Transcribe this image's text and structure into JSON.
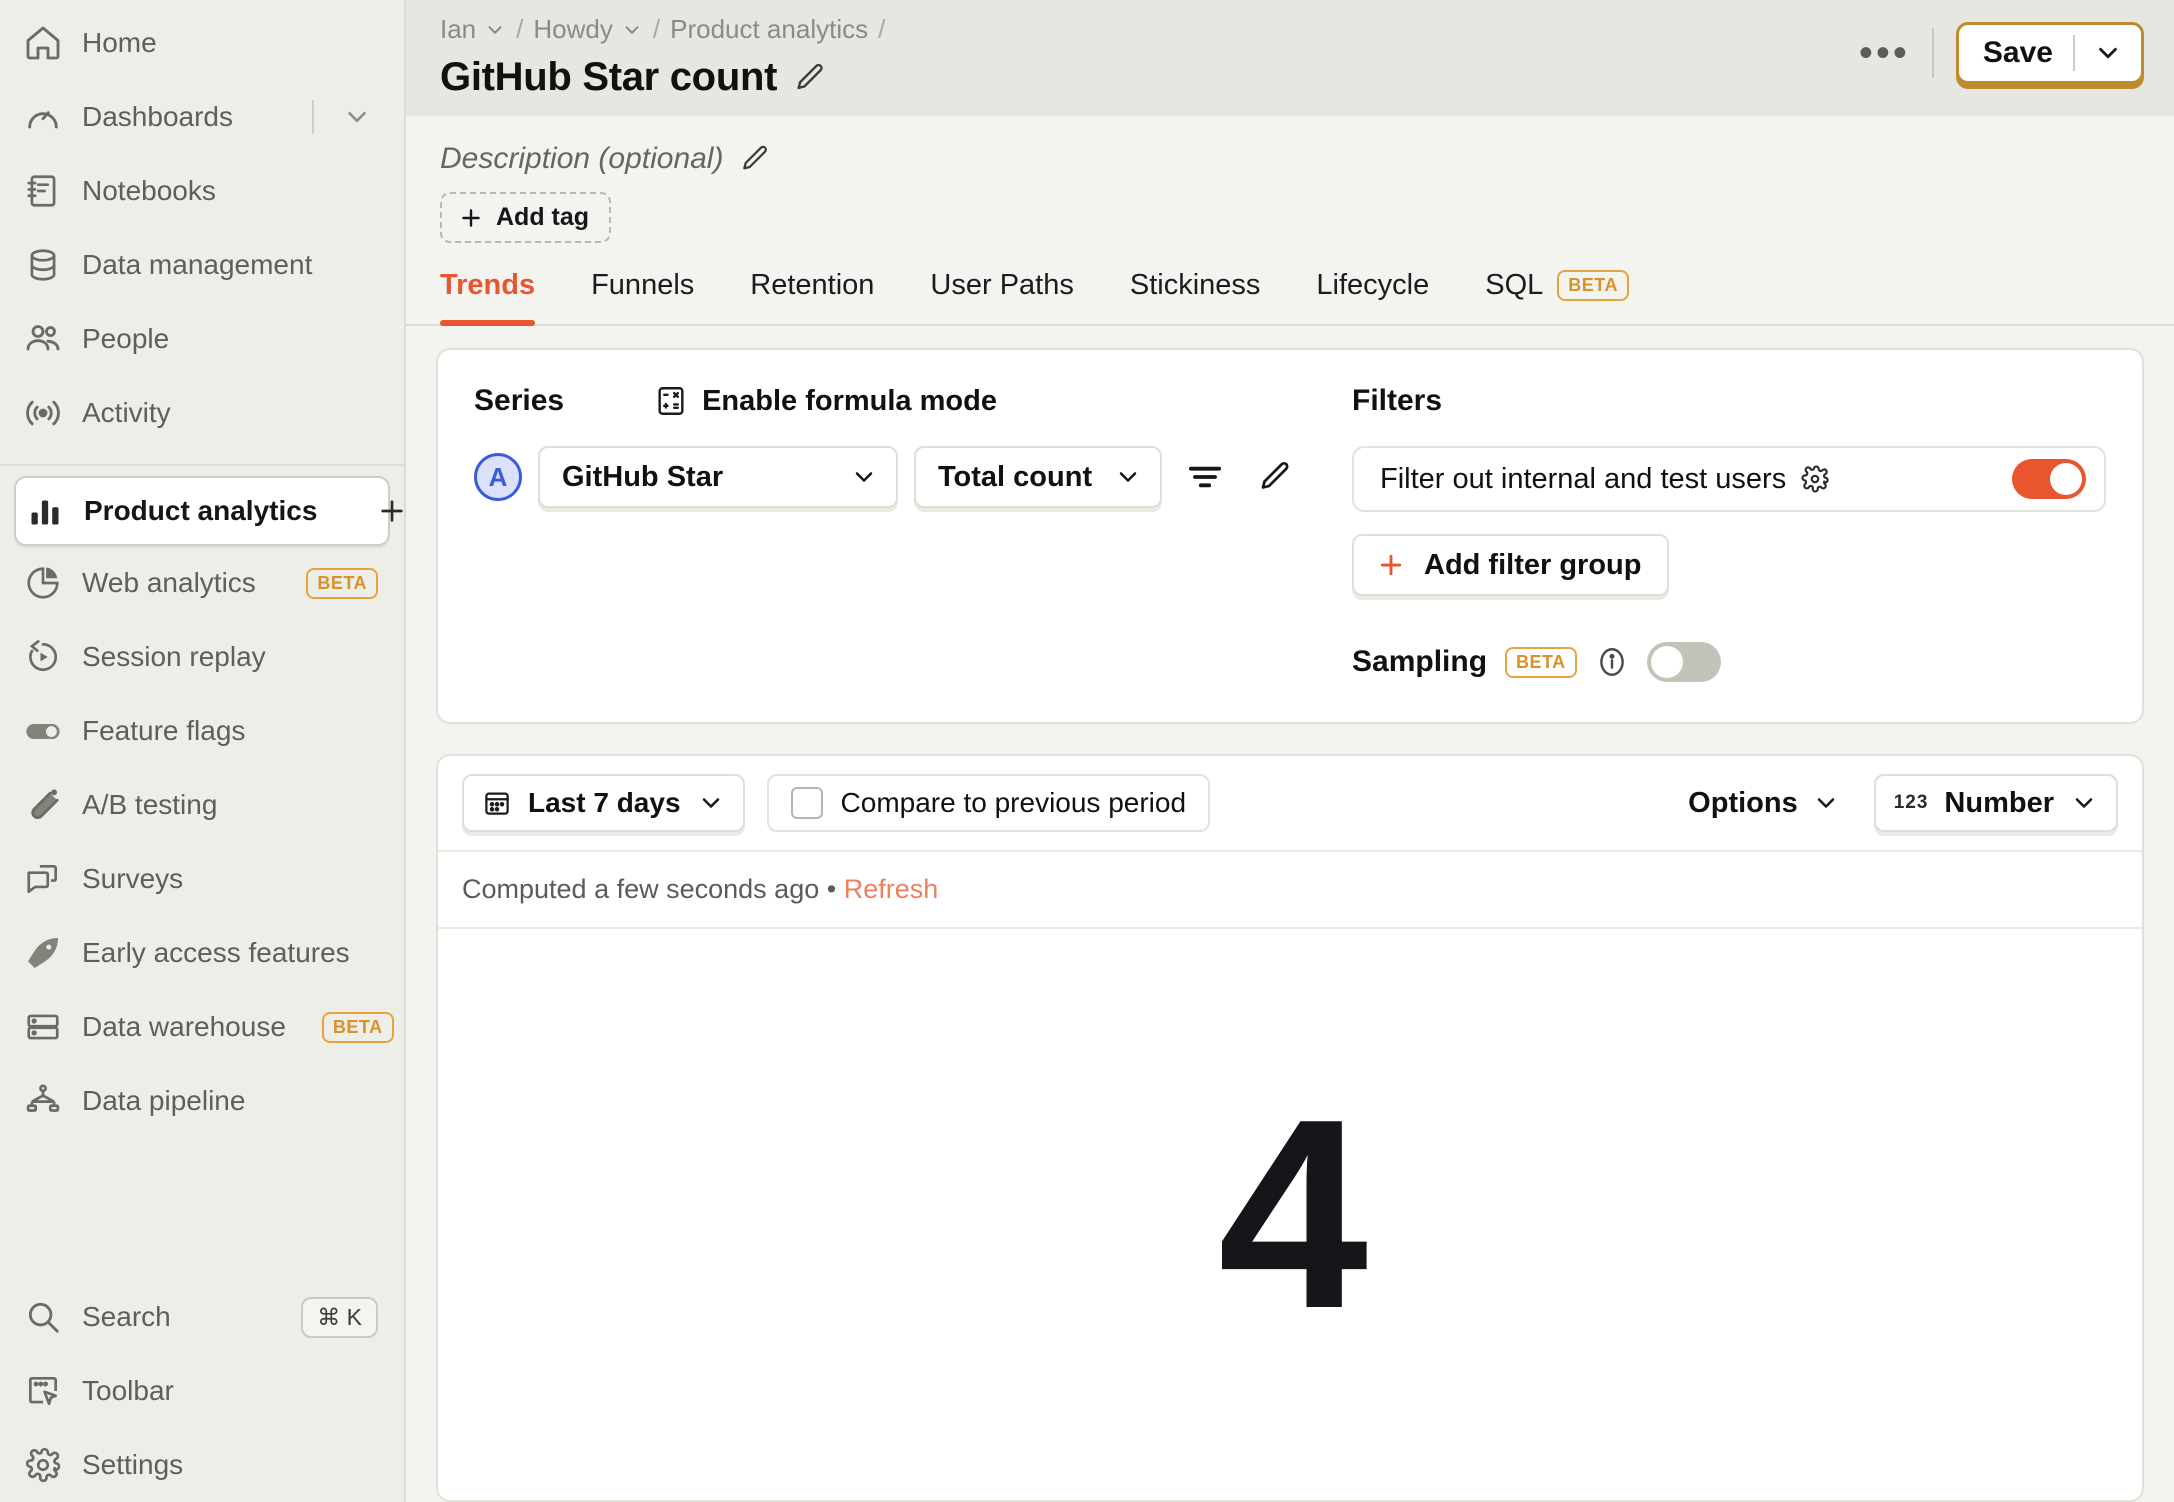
{
  "sidebar": {
    "items": [
      {
        "label": "Home",
        "icon": "home-icon",
        "badge": null,
        "active": false,
        "has_chevron": false,
        "has_plus": false
      },
      {
        "label": "Dashboards",
        "icon": "dashboard-gauge-icon",
        "badge": null,
        "active": false,
        "has_chevron": true,
        "has_plus": false
      },
      {
        "label": "Notebooks",
        "icon": "notebook-icon",
        "badge": null,
        "active": false,
        "has_chevron": false,
        "has_plus": false
      },
      {
        "label": "Data management",
        "icon": "database-icon",
        "badge": null,
        "active": false,
        "has_chevron": false,
        "has_plus": false
      },
      {
        "label": "People",
        "icon": "people-icon",
        "badge": null,
        "active": false,
        "has_chevron": false,
        "has_plus": false
      },
      {
        "label": "Activity",
        "icon": "activity-broadcast-icon",
        "badge": null,
        "active": false,
        "has_chevron": false,
        "has_plus": false
      }
    ],
    "items2": [
      {
        "label": "Product analytics",
        "icon": "bar-chart-icon",
        "badge": null,
        "active": true,
        "has_chevron": false,
        "has_plus": true
      },
      {
        "label": "Web analytics",
        "icon": "pie-chart-icon",
        "badge": "BETA",
        "active": false,
        "has_chevron": false,
        "has_plus": false
      },
      {
        "label": "Session replay",
        "icon": "replay-icon",
        "badge": null,
        "active": false,
        "has_chevron": false,
        "has_plus": false
      },
      {
        "label": "Feature flags",
        "icon": "toggle-icon",
        "badge": null,
        "active": false,
        "has_chevron": false,
        "has_plus": false
      },
      {
        "label": "A/B testing",
        "icon": "flask-icon",
        "badge": null,
        "active": false,
        "has_chevron": false,
        "has_plus": false
      },
      {
        "label": "Surveys",
        "icon": "chat-bubbles-icon",
        "badge": null,
        "active": false,
        "has_chevron": false,
        "has_plus": false
      },
      {
        "label": "Early access features",
        "icon": "rocket-icon",
        "badge": null,
        "active": false,
        "has_chevron": false,
        "has_plus": false
      },
      {
        "label": "Data warehouse",
        "icon": "server-icon",
        "badge": "BETA",
        "active": false,
        "has_chevron": false,
        "has_plus": false
      },
      {
        "label": "Data pipeline",
        "icon": "pipeline-icon",
        "badge": null,
        "active": false,
        "has_chevron": false,
        "has_plus": false
      }
    ],
    "bottom": [
      {
        "label": "Search",
        "icon": "search-icon",
        "kbd": "⌘ K"
      },
      {
        "label": "Toolbar",
        "icon": "toolbar-icon",
        "kbd": null
      },
      {
        "label": "Settings",
        "icon": "gear-icon",
        "kbd": null
      }
    ]
  },
  "header": {
    "breadcrumbs": [
      {
        "label": "Ian",
        "chevron": true
      },
      {
        "label": "Howdy",
        "chevron": true
      },
      {
        "label": "Product analytics",
        "chevron": false
      }
    ],
    "separator": "/",
    "title": "GitHub Star count",
    "more_label": "•••",
    "save_label": "Save"
  },
  "meta": {
    "description_placeholder": "Description (optional)",
    "add_tag_label": "Add tag",
    "add_tag_plus": "+"
  },
  "tabs": {
    "items": [
      {
        "label": "Trends",
        "active": true,
        "badge": null
      },
      {
        "label": "Funnels",
        "active": false,
        "badge": null
      },
      {
        "label": "Retention",
        "active": false,
        "badge": null
      },
      {
        "label": "User Paths",
        "active": false,
        "badge": null
      },
      {
        "label": "Stickiness",
        "active": false,
        "badge": null
      },
      {
        "label": "Lifecycle",
        "active": false,
        "badge": null
      },
      {
        "label": "SQL",
        "active": false,
        "badge": "BETA"
      }
    ]
  },
  "query": {
    "series_heading": "Series",
    "formula_mode_label": "Enable formula mode",
    "series_badge": "A",
    "event_value": "GitHub Star",
    "math_value": "Total count",
    "filters_heading": "Filters",
    "internal_filter_label": "Filter out internal and test users",
    "internal_filter_on": true,
    "add_filter_group_label": "Add filter group",
    "add_filter_group_plus": "+",
    "sampling_label": "Sampling",
    "sampling_badge": "BETA",
    "sampling_on": false
  },
  "result": {
    "date_range": "Last 7 days",
    "compare_label": "Compare to previous period",
    "compare_checked": false,
    "options_label": "Options",
    "viz_label": "Number",
    "viz_icon_text": "123",
    "computed_text": "Computed a few seconds ago",
    "computed_sep": "•",
    "refresh_label": "Refresh"
  },
  "chart_data": {
    "type": "table",
    "title": "GitHub Star count",
    "series_name": "GitHub Star",
    "aggregation": "Total count",
    "date_range": "Last 7 days",
    "categories": [
      "GitHub Star"
    ],
    "values": [
      4
    ],
    "display_value": "4",
    "xlabel": "",
    "ylabel": ""
  },
  "colors": {
    "accent": "#e8552f",
    "beta": "#e8a33d",
    "save_border": "#c08b2e",
    "series_badge": "#3b5bdb",
    "refresh": "#ef7f5e"
  }
}
